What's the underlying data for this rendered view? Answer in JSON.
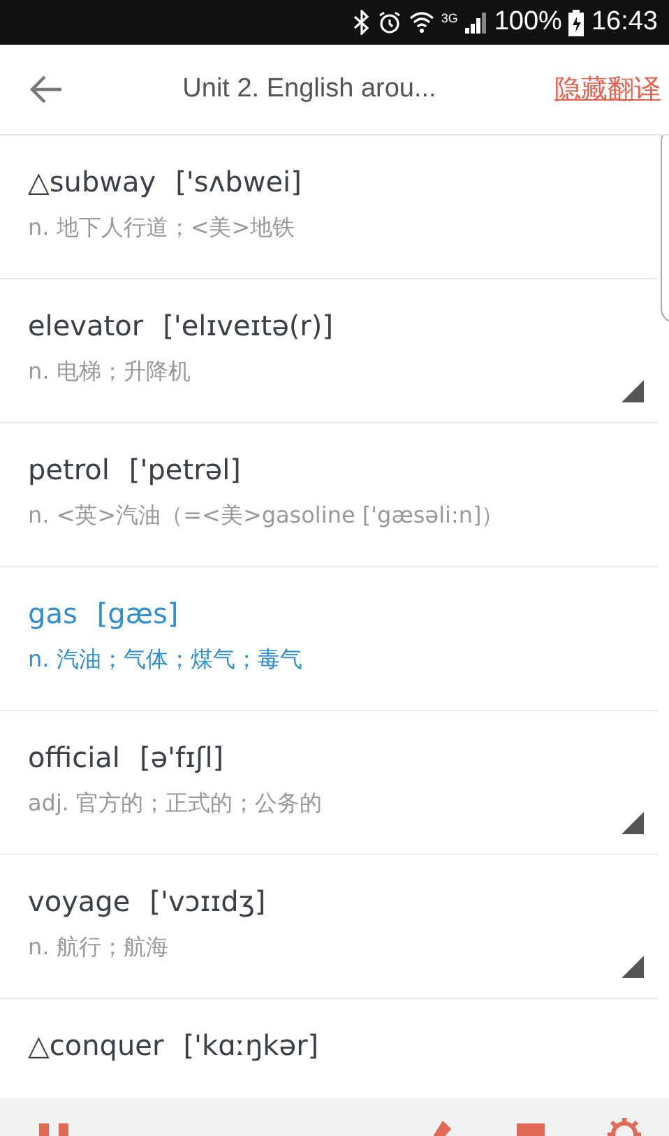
{
  "status_bar": {
    "network": "3G",
    "battery": "100%",
    "time": "16:43"
  },
  "header": {
    "title": "Unit 2. English arou...",
    "action": "隐藏翻译"
  },
  "words": [
    {
      "word": "△subway",
      "phonetic": "['sʌbwei]",
      "definition": "n. 地下人行道；<美>地铁",
      "selected": false,
      "marked": false
    },
    {
      "word": "elevator",
      "phonetic": "['elɪveɪtə(r)]",
      "definition": "n. 电梯；升降机",
      "selected": false,
      "marked": true
    },
    {
      "word": "petrol",
      "phonetic": "['petrəl]",
      "definition": "n. <英>汽油（=<美>gasoline ['gæsəli:n]）",
      "selected": false,
      "marked": false
    },
    {
      "word": "gas",
      "phonetic": "[gæs]",
      "definition": "n. 汽油；气体；煤气；毒气",
      "selected": true,
      "marked": false
    },
    {
      "word": "official",
      "phonetic": "[ə'fɪʃl]",
      "definition": "adj. 官方的；正式的；公务的",
      "selected": false,
      "marked": true
    },
    {
      "word": "voyage",
      "phonetic": "['vɔɪɪdʒ]",
      "definition": "n. 航行；航海",
      "selected": false,
      "marked": true
    },
    {
      "word": "△conquer",
      "phonetic": "['kɑːŋkər]",
      "selected": false,
      "marked": false
    }
  ]
}
